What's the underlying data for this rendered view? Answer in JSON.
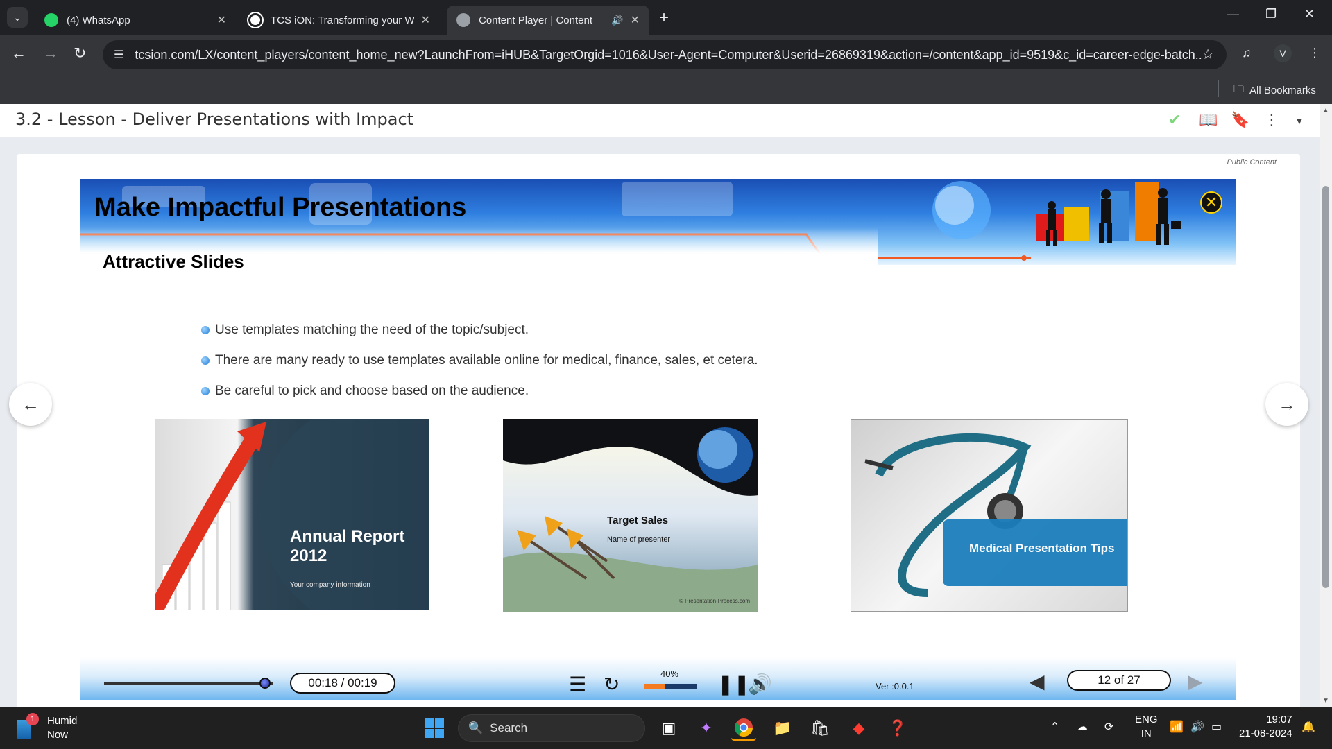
{
  "browser": {
    "tabs": [
      {
        "title": "(4) WhatsApp",
        "icon": "whatsapp-icon",
        "active": false
      },
      {
        "title": "TCS iON: Transforming your Wo",
        "icon": "tcs-icon",
        "active": false
      },
      {
        "title": "Content Player | Content",
        "icon": "globe-icon",
        "active": true
      }
    ],
    "url": "tcsion.com/LX/content_players/content_home_new?LaunchFrom=iHUB&TargetOrgid=1016&User-Agent=Computer&Userid=26869319&action=/content&app_id=9519&c_id=career-edge-batch...",
    "profile_initial": "V",
    "bookmarks_label": "All Bookmarks"
  },
  "lesson": {
    "title": "3.2 - Lesson - Deliver Presentations with Impact",
    "public_label": "Public Content"
  },
  "slide": {
    "banner_title": "Make Impactful Presentations",
    "subtitle": "Attractive Slides",
    "bullets": [
      "Use templates matching the need of the topic/subject.",
      "There are many ready to use templates available online for medical, finance, sales, et cetera.",
      "Be careful to pick and choose based on the audience."
    ],
    "thumbnails": [
      {
        "title": "Annual Report",
        "year": "2012",
        "caption": "Your company information"
      },
      {
        "title": "Target Sales",
        "caption": "Name of presenter",
        "credit": "© Presentation-Process.com"
      },
      {
        "title": "Medical Presentation Tips"
      }
    ]
  },
  "player": {
    "time": "00:18 / 00:19",
    "progress": 0.95,
    "volume_label": "40%",
    "volume": 0.4,
    "version": "Ver :0.0.1",
    "page": "12 of 27"
  },
  "taskbar": {
    "notification_name": "Humid",
    "notification_time": "Now",
    "notification_count": "1",
    "search_label": "Search",
    "lang_top": "ENG",
    "lang_bottom": "IN",
    "time": "19:07",
    "date": "21-08-2024"
  }
}
